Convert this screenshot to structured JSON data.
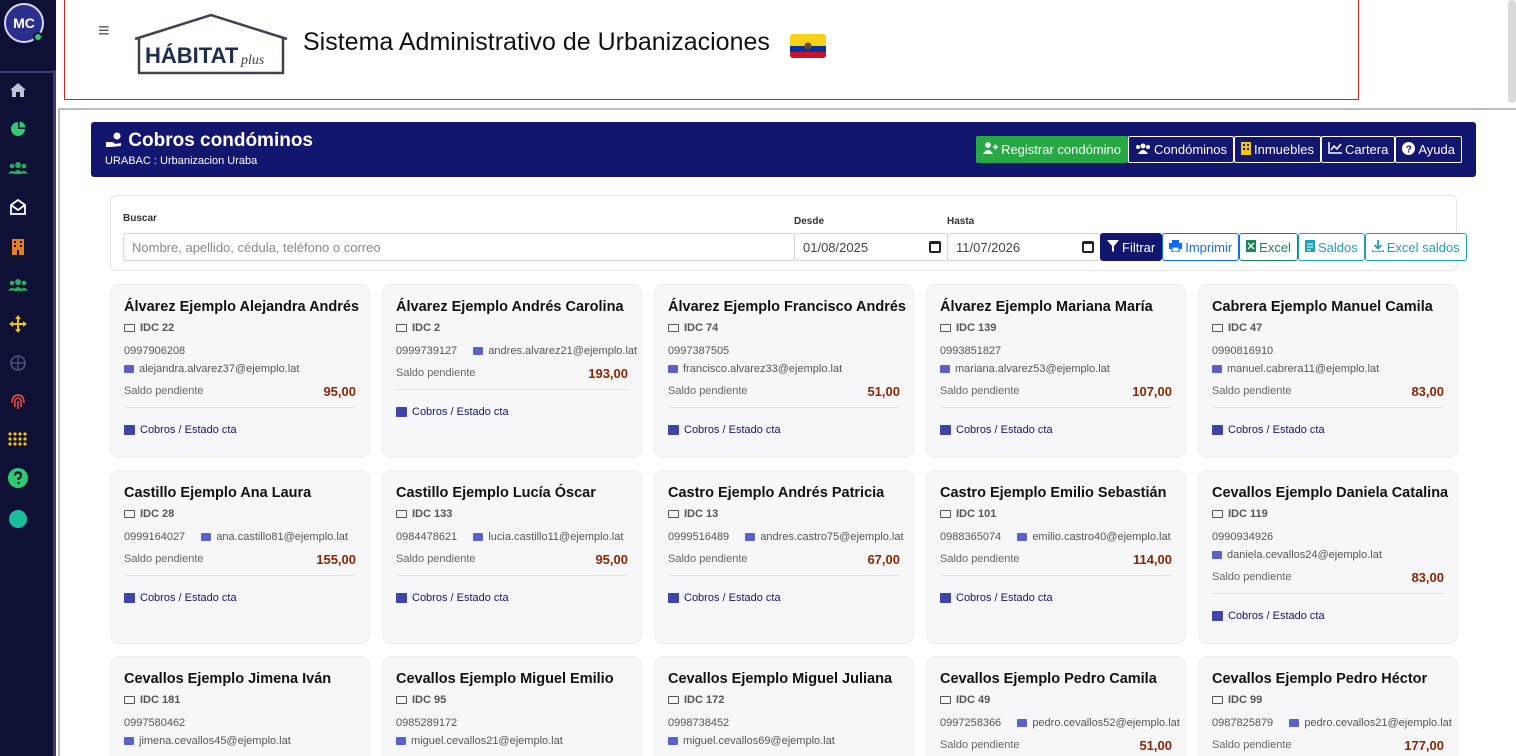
{
  "sidebar": {
    "avatar_initials": "MC",
    "icons": [
      {
        "name": "home-icon",
        "color": "#bfc3d8"
      },
      {
        "name": "pie-chart-icon",
        "color": "#2ecc71"
      },
      {
        "name": "users-icon",
        "color": "#27ae60"
      },
      {
        "name": "envelope-open-icon",
        "color": "#ffffff"
      },
      {
        "name": "building-icon",
        "color": "#e67e22"
      },
      {
        "name": "users-group-icon",
        "color": "#27ae60"
      },
      {
        "name": "arrows-move-icon",
        "color": "#f1c40f"
      },
      {
        "name": "globe-icon",
        "color": "#4a4d7a"
      },
      {
        "name": "fingerprint-icon",
        "color": "#e74c3c"
      },
      {
        "name": "grid-dots-icon",
        "color": "#f1c40f"
      },
      {
        "name": "question-icon",
        "color": "#2ecc71"
      },
      {
        "name": "status-dot-icon",
        "color": "#1abc9c"
      }
    ]
  },
  "header": {
    "logo_text": "HÁBITAT",
    "logo_suffix": "plus",
    "title": "Sistema Administrativo de Urbanizaciones"
  },
  "banner": {
    "title": "Cobros condóminos",
    "subtitle": "URABAC : Urbanizacion Uraba",
    "buttons": {
      "register": "Registrar condómino",
      "condominos": "Condóminos",
      "inmuebles": "Inmuebles",
      "cartera": "Cartera",
      "ayuda": "Ayuda"
    }
  },
  "filter": {
    "search_label": "Buscar",
    "search_placeholder": "Nombre, apellido, cédula, teléfono o correo",
    "desde_label": "Desde",
    "desde_value": "01/08/2025",
    "hasta_label": "Hasta",
    "hasta_value": "11/07/2026",
    "buttons": {
      "filtrar": "Filtrar",
      "imprimir": "Imprimir",
      "excel": "Excel",
      "saldos": "Saldos",
      "excel_saldos": "Excel saldos"
    }
  },
  "card_labels": {
    "saldo": "Saldo pendiente",
    "link": "Cobros / Estado cta"
  },
  "cards": [
    {
      "name": "Álvarez Ejemplo Alejandra Andrés",
      "idc": "IDC 22",
      "phone": "0997906208",
      "email": "alejandra.alvarez37@ejemplo.lat",
      "saldo": "95,00"
    },
    {
      "name": "Álvarez Ejemplo Andrés Carolina",
      "idc": "IDC 2",
      "phone": "0999739127",
      "email": "andres.alvarez21@ejemplo.lat",
      "saldo": "193,00"
    },
    {
      "name": "Álvarez Ejemplo Francisco Andrés",
      "idc": "IDC 74",
      "phone": "0997387505",
      "email": "francisco.alvarez33@ejemplo.lat",
      "saldo": "51,00"
    },
    {
      "name": "Álvarez Ejemplo Mariana María",
      "idc": "IDC 139",
      "phone": "0993851827",
      "email": "mariana.alvarez53@ejemplo.lat",
      "saldo": "107,00"
    },
    {
      "name": "Cabrera Ejemplo Manuel Camila",
      "idc": "IDC 47",
      "phone": "0990816910",
      "email": "manuel.cabrera11@ejemplo.lat",
      "saldo": "83,00"
    },
    {
      "name": "Castillo Ejemplo Ana Laura",
      "idc": "IDC 28",
      "phone": "0999164027",
      "email": "ana.castillo81@ejemplo.lat",
      "saldo": "155,00"
    },
    {
      "name": "Castillo Ejemplo Lucía Óscar",
      "idc": "IDC 133",
      "phone": "0984478621",
      "email": "lucia.castillo11@ejemplo.lat",
      "saldo": "95,00"
    },
    {
      "name": "Castro Ejemplo Andrés Patricia",
      "idc": "IDC 13",
      "phone": "0999516489",
      "email": "andres.castro75@ejemplo.lat",
      "saldo": "67,00"
    },
    {
      "name": "Castro Ejemplo Emilio Sebastián",
      "idc": "IDC 101",
      "phone": "0988365074",
      "email": "emilio.castro40@ejemplo.lat",
      "saldo": "114,00"
    },
    {
      "name": "Cevallos Ejemplo Daniela Catalina",
      "idc": "IDC 119",
      "phone": "0990934926",
      "email": "daniela.cevallos24@ejemplo.lat",
      "saldo": "83,00"
    },
    {
      "name": "Cevallos Ejemplo Jimena Iván",
      "idc": "IDC 181",
      "phone": "0997580462",
      "email": "jimena.cevallos45@ejemplo.lat",
      "saldo": ""
    },
    {
      "name": "Cevallos Ejemplo Miguel Emilio",
      "idc": "IDC 95",
      "phone": "0985289172",
      "email": "miguel.cevallos21@ejemplo.lat",
      "saldo": ""
    },
    {
      "name": "Cevallos Ejemplo Miguel Juliana",
      "idc": "IDC 172",
      "phone": "0998738452",
      "email": "miguel.cevallos69@ejemplo.lat",
      "saldo": ""
    },
    {
      "name": "Cevallos Ejemplo Pedro Camila",
      "idc": "IDC 49",
      "phone": "0997258366",
      "email": "pedro.cevallos52@ejemplo.lat",
      "saldo": "51,00"
    },
    {
      "name": "Cevallos Ejemplo Pedro Héctor",
      "idc": "IDC 99",
      "phone": "0987825879",
      "email": "pedro.cevallos21@ejemplo.lat",
      "saldo": "177,00"
    }
  ]
}
